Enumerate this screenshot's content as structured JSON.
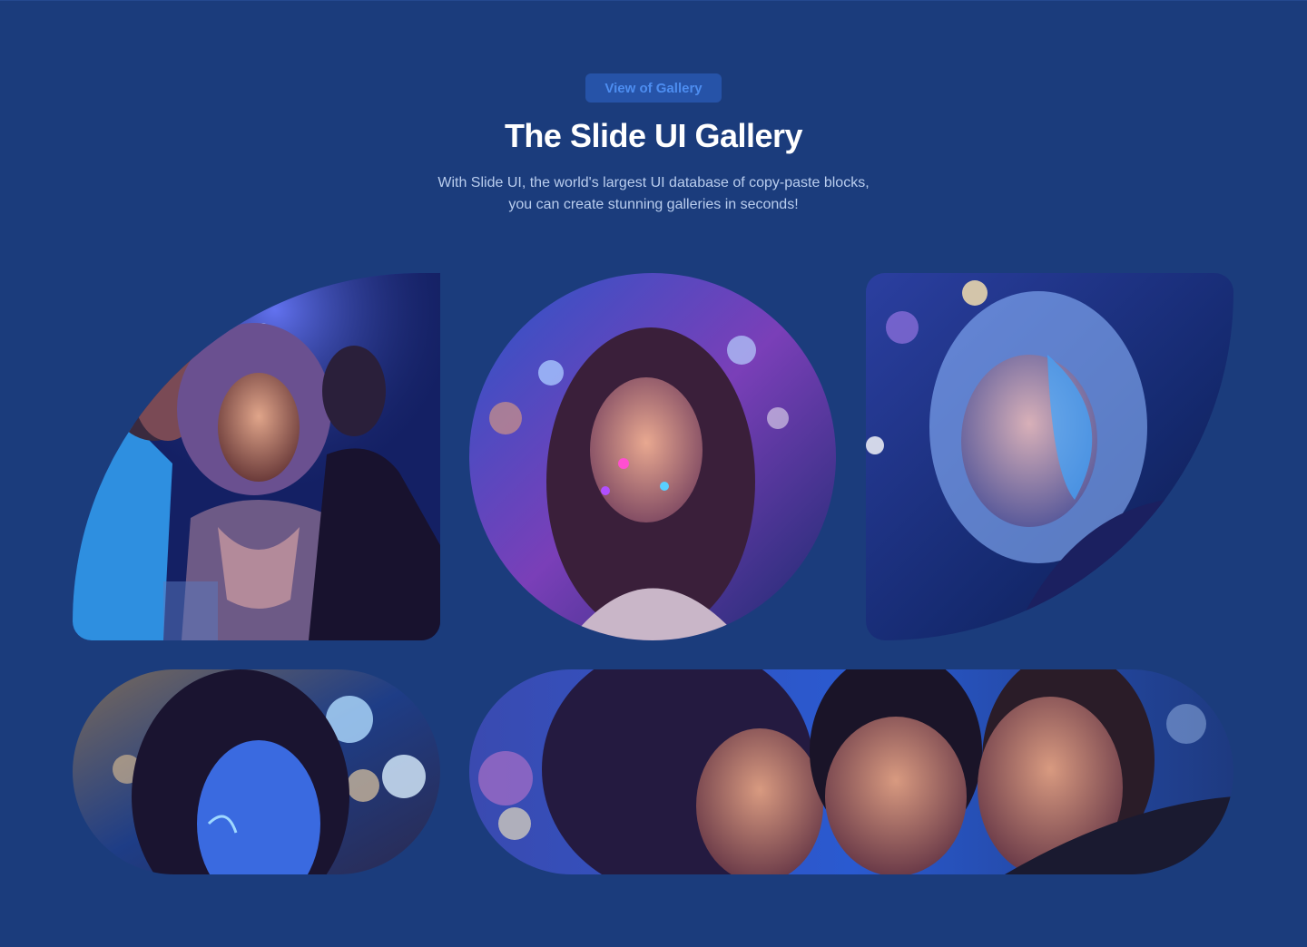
{
  "header": {
    "badge_label": "View of Gallery",
    "title": "The Slide UI Gallery",
    "subtitle_line1": "With Slide UI, the world's largest UI database of copy-paste blocks,",
    "subtitle_line2": "you can create stunning galleries in seconds!"
  },
  "gallery": {
    "items": [
      {
        "alt": "Three friends laughing at a party"
      },
      {
        "alt": "Smiling woman with neon face paint"
      },
      {
        "alt": "Woman with glowing blue face paint"
      },
      {
        "alt": "Woman with blue neon face paint"
      },
      {
        "alt": "Three friends smiling together"
      }
    ]
  },
  "colors": {
    "background": "#1b3c7c",
    "badge_bg": "#2653a8",
    "badge_text": "#4d8df0",
    "title": "#ffffff",
    "subtitle": "#b9cdee"
  }
}
